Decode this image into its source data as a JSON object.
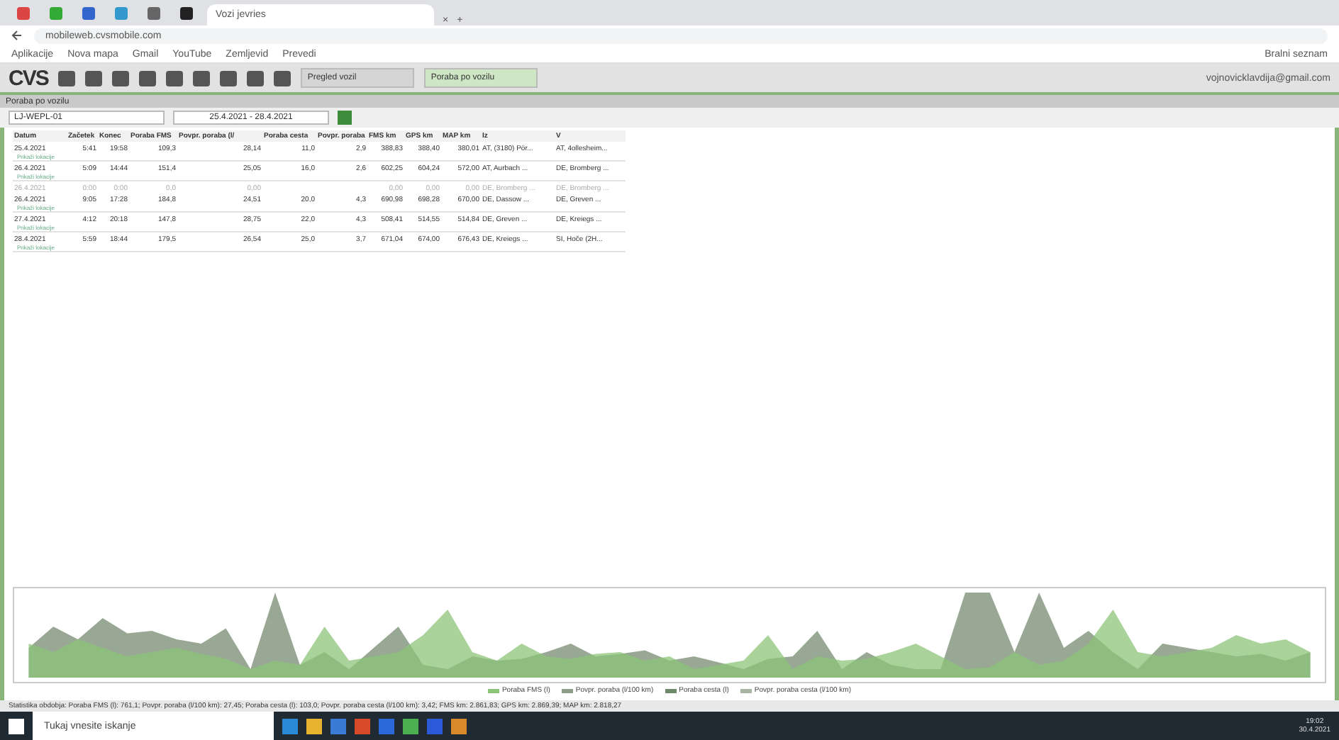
{
  "browser": {
    "tabs": [
      {
        "title": "Vozi jevries",
        "selected": true
      }
    ],
    "close_tab": "×",
    "new_tab": "+",
    "url": "mobileweb.cvsmobile.com",
    "bookmarks": [
      "Aplikacije",
      "Nova mapa",
      "Gmail",
      "YouTube",
      "Zemljevid",
      "Prevedi"
    ],
    "reading_list": "Bralni seznam"
  },
  "app": {
    "logo": "CVS",
    "tabs": [
      {
        "label": "Pregled vozil",
        "selected": false
      },
      {
        "label": "Poraba po vozilu",
        "selected": true
      }
    ],
    "user": "vojnovicklavdija@gmail.com"
  },
  "panel": {
    "title": "Poraba po vozilu",
    "vehicle": "LJ-WEPL-01",
    "date_range": "25.4.2021 - 28.4.2021"
  },
  "table": {
    "columns": [
      "Datum",
      "Začetek",
      "Konec",
      "Poraba FMS",
      "Povpr. poraba (l/",
      "Poraba cesta",
      "Povpr. poraba",
      "FMS km",
      "GPS km",
      "MAP km",
      "Iz",
      "V"
    ],
    "rows": [
      {
        "disabled": false,
        "cells": [
          "25.4.2021",
          "5:41",
          "19:58",
          "109,3",
          "28,14",
          "11,0",
          "2,9",
          "388,83",
          "388,40",
          "380,01",
          "AT, (3180) Pör...",
          "AT, 4ollesheim..."
        ],
        "sub": "Prikaži lokacije"
      },
      {
        "disabled": false,
        "cells": [
          "26.4.2021",
          "5:09",
          "14:44",
          "151,4",
          "25,05",
          "16,0",
          "2,6",
          "602,25",
          "604,24",
          "572,00",
          "AT, Aurbach ...",
          "DE, Bromberg ..."
        ],
        "sub": "Prikaži lokacije"
      },
      {
        "disabled": true,
        "cells": [
          "26.4.2021",
          "0:00",
          "0:00",
          "0,0",
          "0,00",
          "",
          "",
          "0,00",
          "0,00",
          "0,00",
          "DE, Bromberg ...",
          "DE, Bromberg ..."
        ]
      },
      {
        "disabled": false,
        "cells": [
          "26.4.2021",
          "9:05",
          "17:28",
          "184,8",
          "24,51",
          "20,0",
          "4,3",
          "690,98",
          "698,28",
          "670,00",
          "DE, Dassow ...",
          "DE, Greven ..."
        ],
        "sub": "Prikaži lokacije"
      },
      {
        "disabled": false,
        "cells": [
          "27.4.2021",
          "4:12",
          "20:18",
          "147,8",
          "28,75",
          "22,0",
          "4,3",
          "508,41",
          "514,55",
          "514,84",
          "DE, Greven ...",
          "DE, Kreiegs ..."
        ],
        "sub": "Prikaži lokacije"
      },
      {
        "disabled": false,
        "cells": [
          "28.4.2021",
          "5:59",
          "18:44",
          "179,5",
          "26,54",
          "25,0",
          "3,7",
          "671,04",
          "674,00",
          "676,43",
          "DE, Kreiegs ...",
          "SI, Hoče (2H..."
        ],
        "sub": "Prikaži lokacije"
      }
    ]
  },
  "chart": {
    "legend": [
      {
        "label": "Poraba FMS (l)",
        "color": "#8cc47a"
      },
      {
        "label": "Povpr. poraba (l/100 km)",
        "color": "#8e9e8a"
      },
      {
        "label": "Poraba cesta (l)",
        "color": "#6f8a6a"
      },
      {
        "label": "Povpr. poraba cesta (l/100 km)",
        "color": "#a7b3a3"
      }
    ]
  },
  "status_bar": "Statistika obdobja: Poraba FMS (l): 761,1; Povpr. poraba (l/100 km): 27,45; Poraba cesta (l): 103,0; Povpr. poraba cesta (l/100 km): 3,42; FMS km: 2.861,83; GPS km: 2.869,39; MAP km: 2.818,27",
  "taskbar": {
    "search_placeholder": "Tukaj vnesite iskanje",
    "time": "19:02",
    "date": "30.4.2021"
  }
}
